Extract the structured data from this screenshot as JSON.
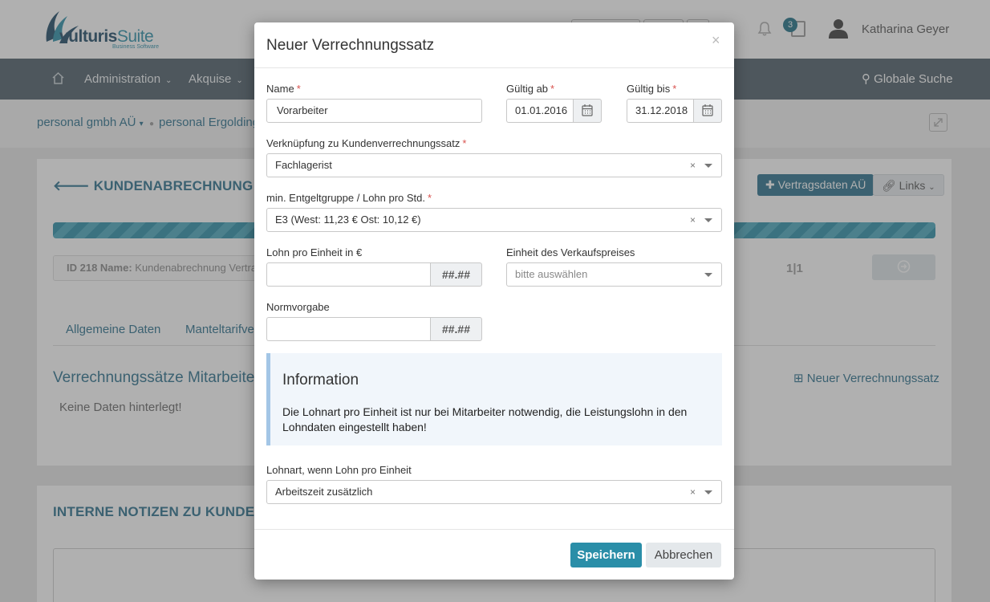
{
  "header": {
    "brand_primary": "vulturis",
    "brand_secondary": "Suite",
    "brand_tagline": "Business Software",
    "notification_count": "3",
    "user_name": "Katharina Geyer"
  },
  "nav": {
    "items": [
      {
        "label": "Administration"
      },
      {
        "label": "Akquise"
      }
    ],
    "search_label": "Globale Suche"
  },
  "breadcrumb": {
    "items": [
      "personal gmbh AÜ",
      "personal Ergolding"
    ]
  },
  "page": {
    "panel_title": "KUNDENABRECHNUNG VERTR",
    "btn_vertragsdaten": "Vertragsdaten AÜ",
    "btn_links": "Links",
    "id_label": "ID 218 Name:",
    "id_value": "Kundenabrechnung Vertrag",
    "pager": "1|1",
    "tabs": [
      {
        "label": "Allgemeine Daten"
      },
      {
        "label": "Manteltarifve"
      }
    ],
    "section_title": "Verrechnungssätze Mitarbeite",
    "new_link": "Neuer Verrechnungssatz",
    "no_data": "Keine Daten hinterlegt!",
    "notes_title": "INTERNE NOTIZEN ZU KUNDENA"
  },
  "modal": {
    "title": "Neuer Verrechnungssatz",
    "close_glyph": "×",
    "fields": {
      "name": {
        "label": "Name",
        "value": "Vorarbeiter",
        "required": "*"
      },
      "valid_from": {
        "label": "Gültig ab",
        "value": "01.01.2016",
        "required": "*"
      },
      "valid_to": {
        "label": "Gültig bis",
        "value": "31.12.2018",
        "required": "*"
      },
      "link": {
        "label": "Verknüpfung zu Kundenverrechnungssatz",
        "value": "Fachlagerist",
        "required": "*"
      },
      "min_group": {
        "label": "min. Entgeltgruppe / Lohn pro Std.",
        "value": "E3 (West: 11,23 € Ost: 10,12 €)",
        "required": "*"
      },
      "wage_unit": {
        "label": "Lohn pro Einheit in €",
        "value": "",
        "addon": "##.##"
      },
      "sales_unit": {
        "label": "Einheit des Verkaufspreises",
        "placeholder": "bitte auswählen"
      },
      "norm": {
        "label": "Normvorgabe",
        "value": "",
        "addon": "##.##"
      },
      "wage_type": {
        "label": "Lohnart, wenn Lohn pro Einheit",
        "value": "Arbeitszeit zusätzlich"
      }
    },
    "clear_glyph": "×",
    "info": {
      "title": "Information",
      "text": "Die Lohnart pro Einheit ist nur bei Mitarbeiter notwendig, die Leistungslohn in den Lohndaten eingestellt haben!"
    },
    "buttons": {
      "save": "Speichern",
      "cancel": "Abbrechen"
    }
  },
  "colors": {
    "accent": "#2a8ea8",
    "navbar": "#4d5d68",
    "link": "#2a6f8c",
    "required": "#d9534f",
    "info_border": "#a3c6e6"
  }
}
